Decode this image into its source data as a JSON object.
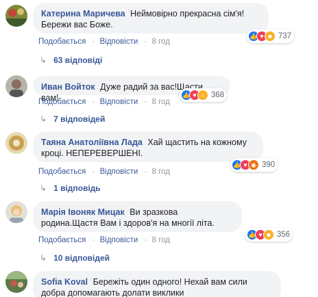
{
  "comments": [
    {
      "author": "Катерина Маричева",
      "text": "Неймовірно прекрасна сім'я!Бережи вас Боже.",
      "reaction_count": "737",
      "reactions": [
        "like-icon",
        "love-icon",
        "haha-icon"
      ],
      "actions": {
        "like": "Подобається",
        "reply": "Відповісти",
        "time": "8 год"
      },
      "replies": "63 відповіді"
    },
    {
      "author": "Иван Войток",
      "text": "Дуже радий за вас!Щасти вам!",
      "reaction_count": "368",
      "reactions": [
        "like-icon",
        "love-icon",
        "wow-icon"
      ],
      "actions": {
        "like": "Подобається",
        "reply": "Відповісти",
        "time": "8 год"
      },
      "replies": "7 відповідей"
    },
    {
      "author": "Таяна Анатоліївна Лада",
      "text": "Хай щастить на кожному кроці. НЕПЕРЕВЕРШЕНІ.",
      "reaction_count": "390",
      "reactions": [
        "like-icon",
        "love-icon",
        "angry-icon"
      ],
      "actions": {
        "like": "Подобається",
        "reply": "Відповісти",
        "time": "8 год"
      },
      "replies": "1 відповідь"
    },
    {
      "author": "Марія Івоняк Мицак",
      "text": "Ви зразкова родина.Щастя Вам і здоров'я на многії літа.",
      "reaction_count": "356",
      "reactions": [
        "like-icon",
        "love-icon",
        "haha-icon"
      ],
      "actions": {
        "like": "Подобається",
        "reply": "Відповісти",
        "time": "8 год"
      },
      "replies": "10 відповідей"
    },
    {
      "author": "Sofia Koval",
      "text": "Бережіть один одного! Нехай вам сили добра допомагають долати виклики",
      "reaction_count": "",
      "reactions": [],
      "actions": {},
      "replies": ""
    }
  ],
  "separator": "·",
  "reply_arrow": "↳",
  "colors": {
    "link": "#385898",
    "bubble": "#f2f3f5",
    "muted": "#90949c"
  }
}
